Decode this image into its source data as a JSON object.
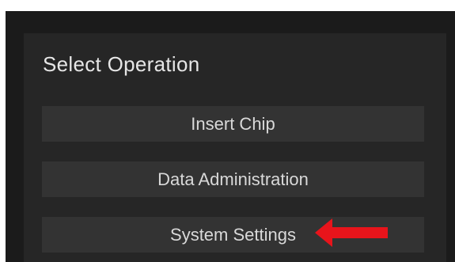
{
  "dialog": {
    "title": "Select Operation",
    "buttons": [
      {
        "label": "Insert Chip"
      },
      {
        "label": "Data Administration"
      },
      {
        "label": "System Settings"
      }
    ]
  },
  "annotation": {
    "arrow_color": "#e8141b",
    "points_to": "System Settings"
  },
  "colors": {
    "background": "#1b1b1b",
    "panel": "#262626",
    "button": "#333333",
    "text": "#e6e6e6"
  }
}
